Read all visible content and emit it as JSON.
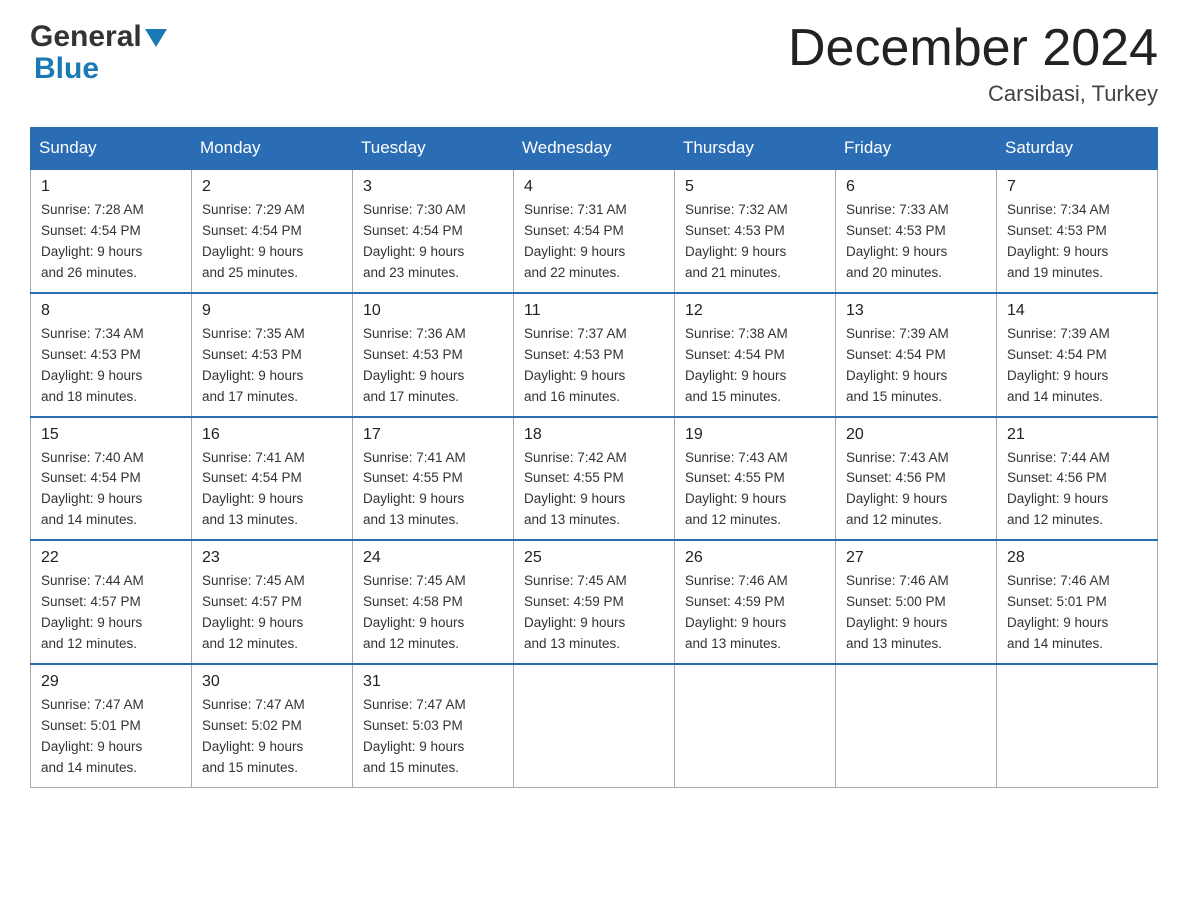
{
  "logo": {
    "general": "General",
    "blue": "Blue"
  },
  "header": {
    "month": "December 2024",
    "location": "Carsibasi, Turkey"
  },
  "weekdays": [
    "Sunday",
    "Monday",
    "Tuesday",
    "Wednesday",
    "Thursday",
    "Friday",
    "Saturday"
  ],
  "weeks": [
    [
      {
        "day": "1",
        "sunrise": "7:28 AM",
        "sunset": "4:54 PM",
        "daylight": "9 hours and 26 minutes."
      },
      {
        "day": "2",
        "sunrise": "7:29 AM",
        "sunset": "4:54 PM",
        "daylight": "9 hours and 25 minutes."
      },
      {
        "day": "3",
        "sunrise": "7:30 AM",
        "sunset": "4:54 PM",
        "daylight": "9 hours and 23 minutes."
      },
      {
        "day": "4",
        "sunrise": "7:31 AM",
        "sunset": "4:54 PM",
        "daylight": "9 hours and 22 minutes."
      },
      {
        "day": "5",
        "sunrise": "7:32 AM",
        "sunset": "4:53 PM",
        "daylight": "9 hours and 21 minutes."
      },
      {
        "day": "6",
        "sunrise": "7:33 AM",
        "sunset": "4:53 PM",
        "daylight": "9 hours and 20 minutes."
      },
      {
        "day": "7",
        "sunrise": "7:34 AM",
        "sunset": "4:53 PM",
        "daylight": "9 hours and 19 minutes."
      }
    ],
    [
      {
        "day": "8",
        "sunrise": "7:34 AM",
        "sunset": "4:53 PM",
        "daylight": "9 hours and 18 minutes."
      },
      {
        "day": "9",
        "sunrise": "7:35 AM",
        "sunset": "4:53 PM",
        "daylight": "9 hours and 17 minutes."
      },
      {
        "day": "10",
        "sunrise": "7:36 AM",
        "sunset": "4:53 PM",
        "daylight": "9 hours and 17 minutes."
      },
      {
        "day": "11",
        "sunrise": "7:37 AM",
        "sunset": "4:53 PM",
        "daylight": "9 hours and 16 minutes."
      },
      {
        "day": "12",
        "sunrise": "7:38 AM",
        "sunset": "4:54 PM",
        "daylight": "9 hours and 15 minutes."
      },
      {
        "day": "13",
        "sunrise": "7:39 AM",
        "sunset": "4:54 PM",
        "daylight": "9 hours and 15 minutes."
      },
      {
        "day": "14",
        "sunrise": "7:39 AM",
        "sunset": "4:54 PM",
        "daylight": "9 hours and 14 minutes."
      }
    ],
    [
      {
        "day": "15",
        "sunrise": "7:40 AM",
        "sunset": "4:54 PM",
        "daylight": "9 hours and 14 minutes."
      },
      {
        "day": "16",
        "sunrise": "7:41 AM",
        "sunset": "4:54 PM",
        "daylight": "9 hours and 13 minutes."
      },
      {
        "day": "17",
        "sunrise": "7:41 AM",
        "sunset": "4:55 PM",
        "daylight": "9 hours and 13 minutes."
      },
      {
        "day": "18",
        "sunrise": "7:42 AM",
        "sunset": "4:55 PM",
        "daylight": "9 hours and 13 minutes."
      },
      {
        "day": "19",
        "sunrise": "7:43 AM",
        "sunset": "4:55 PM",
        "daylight": "9 hours and 12 minutes."
      },
      {
        "day": "20",
        "sunrise": "7:43 AM",
        "sunset": "4:56 PM",
        "daylight": "9 hours and 12 minutes."
      },
      {
        "day": "21",
        "sunrise": "7:44 AM",
        "sunset": "4:56 PM",
        "daylight": "9 hours and 12 minutes."
      }
    ],
    [
      {
        "day": "22",
        "sunrise": "7:44 AM",
        "sunset": "4:57 PM",
        "daylight": "9 hours and 12 minutes."
      },
      {
        "day": "23",
        "sunrise": "7:45 AM",
        "sunset": "4:57 PM",
        "daylight": "9 hours and 12 minutes."
      },
      {
        "day": "24",
        "sunrise": "7:45 AM",
        "sunset": "4:58 PM",
        "daylight": "9 hours and 12 minutes."
      },
      {
        "day": "25",
        "sunrise": "7:45 AM",
        "sunset": "4:59 PM",
        "daylight": "9 hours and 13 minutes."
      },
      {
        "day": "26",
        "sunrise": "7:46 AM",
        "sunset": "4:59 PM",
        "daylight": "9 hours and 13 minutes."
      },
      {
        "day": "27",
        "sunrise": "7:46 AM",
        "sunset": "5:00 PM",
        "daylight": "9 hours and 13 minutes."
      },
      {
        "day": "28",
        "sunrise": "7:46 AM",
        "sunset": "5:01 PM",
        "daylight": "9 hours and 14 minutes."
      }
    ],
    [
      {
        "day": "29",
        "sunrise": "7:47 AM",
        "sunset": "5:01 PM",
        "daylight": "9 hours and 14 minutes."
      },
      {
        "day": "30",
        "sunrise": "7:47 AM",
        "sunset": "5:02 PM",
        "daylight": "9 hours and 15 minutes."
      },
      {
        "day": "31",
        "sunrise": "7:47 AM",
        "sunset": "5:03 PM",
        "daylight": "9 hours and 15 minutes."
      },
      null,
      null,
      null,
      null
    ]
  ],
  "labels": {
    "sunrise": "Sunrise:",
    "sunset": "Sunset:",
    "daylight": "Daylight:"
  }
}
